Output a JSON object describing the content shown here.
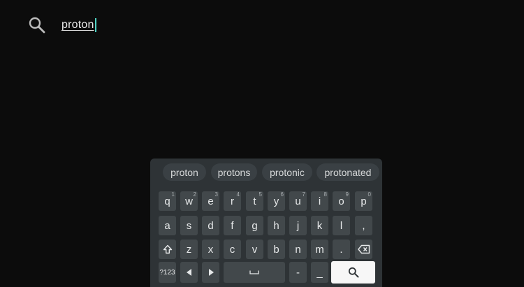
{
  "search": {
    "query": "proton",
    "icon": "search-icon"
  },
  "suggestions": [
    "proton",
    "protons",
    "protonic",
    "protonated"
  ],
  "keyboard": {
    "row1": [
      {
        "key": "q",
        "hint": "1"
      },
      {
        "key": "w",
        "hint": "2"
      },
      {
        "key": "e",
        "hint": "3"
      },
      {
        "key": "r",
        "hint": "4"
      },
      {
        "key": "t",
        "hint": "5"
      },
      {
        "key": "y",
        "hint": "6"
      },
      {
        "key": "u",
        "hint": "7"
      },
      {
        "key": "i",
        "hint": "8"
      },
      {
        "key": "o",
        "hint": "9"
      },
      {
        "key": "p",
        "hint": "0"
      }
    ],
    "row2": [
      "a",
      "s",
      "d",
      "f",
      "g",
      "h",
      "j",
      "k",
      "l",
      ","
    ],
    "row3": [
      "z",
      "x",
      "c",
      "v",
      "b",
      "n",
      "m",
      "."
    ],
    "symbols_label": "?123",
    "space_label": "␣",
    "dash_label": "-",
    "underscore_label": "_",
    "icons": {
      "shift": "shift-icon",
      "backspace": "backspace-icon",
      "cursor_left": "cursor-left-icon",
      "cursor_right": "cursor-right-icon",
      "enter": "search-icon"
    },
    "colors": {
      "panel": "#2e3336",
      "key": "#42484b",
      "enter": "#f7f7f7",
      "caret": "#4fd3c4"
    }
  }
}
